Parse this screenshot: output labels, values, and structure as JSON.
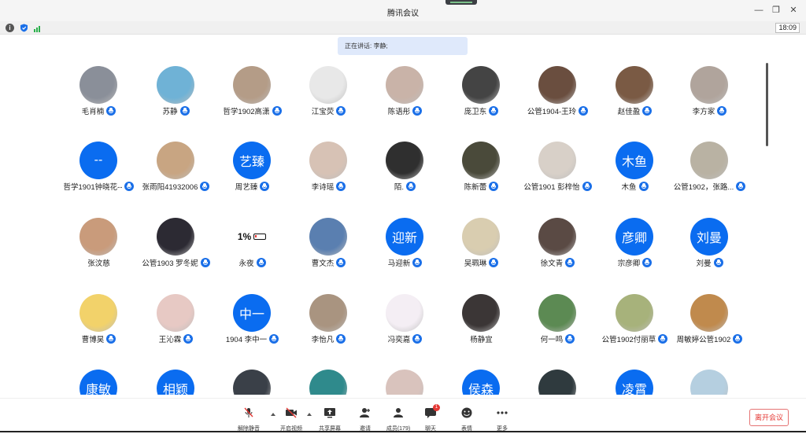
{
  "window": {
    "title": "腾讯会议",
    "controls": [
      "—",
      "❐",
      "✕"
    ]
  },
  "status": {
    "time": "18:09"
  },
  "speaking": {
    "label": "正在讲话: 李静;"
  },
  "colors": {
    "accent": "#0a6cf0",
    "leave": "#e53935"
  },
  "rows": [
    [
      {
        "name": "毛肖楠",
        "avatar": "photo",
        "tone": "#8a8f99",
        "mic": "on"
      },
      {
        "name": "苏静",
        "avatar": "photo",
        "tone": "#6fb2d6",
        "mic": "on"
      },
      {
        "name": "哲学1902高潇",
        "avatar": "photo",
        "tone": "#b49c87",
        "mic": "on"
      },
      {
        "name": "江宝荧",
        "avatar": "photo",
        "tone": "#e8e8e8",
        "mic": "on"
      },
      {
        "name": "陈语彤",
        "avatar": "photo",
        "tone": "#c9b3a8",
        "mic": "on"
      },
      {
        "name": "庞卫东",
        "avatar": "photo",
        "tone": "#444444",
        "mic": "on"
      },
      {
        "name": "公管1904-王玲",
        "avatar": "photo",
        "tone": "#6a4e3f",
        "mic": "on"
      },
      {
        "name": "赵佳盈",
        "avatar": "photo",
        "tone": "#7a5a44",
        "mic": "on"
      },
      {
        "name": "李方家",
        "avatar": "photo",
        "tone": "#b0a49c",
        "mic": "on"
      }
    ],
    [
      {
        "name": "哲学1901钟晓花--",
        "avatar": "text",
        "text": "--",
        "mic": "on"
      },
      {
        "name": "张雨阳41932006",
        "avatar": "photo",
        "tone": "#c8a582",
        "mic": "on"
      },
      {
        "name": "周艺臻",
        "avatar": "text",
        "text": "艺臻",
        "mic": "on"
      },
      {
        "name": "李诗瑶",
        "avatar": "photo",
        "tone": "#d7c2b5",
        "mic": "on"
      },
      {
        "name": "陌.",
        "avatar": "photo",
        "tone": "#2f2f2f",
        "mic": "on"
      },
      {
        "name": "陈新蕾",
        "avatar": "photo",
        "tone": "#4a4a3a",
        "mic": "on"
      },
      {
        "name": "公管1901 彭梓怡",
        "avatar": "photo",
        "tone": "#d8d0c8",
        "mic": "on"
      },
      {
        "name": "木鱼",
        "avatar": "text",
        "text": "木鱼",
        "mic": "on"
      },
      {
        "name": "公管1902，张路...",
        "avatar": "photo",
        "tone": "#b9b2a3",
        "mic": "on"
      }
    ],
    [
      {
        "name": "张汶慈",
        "avatar": "photo",
        "tone": "#c99b7b",
        "mic": "none"
      },
      {
        "name": "公管1903 罗冬妮",
        "avatar": "photo",
        "tone": "#2c2a33",
        "mic": "on"
      },
      {
        "name": "永夜",
        "avatar": "battery",
        "text": "1%",
        "mic": "on"
      },
      {
        "name": "曹文杰",
        "avatar": "photo",
        "tone": "#5a7fb0",
        "mic": "on"
      },
      {
        "name": "马迎新",
        "avatar": "text",
        "text": "迎新",
        "mic": "on"
      },
      {
        "name": "吴珮琳",
        "avatar": "photo",
        "tone": "#d9cdb0",
        "mic": "on"
      },
      {
        "name": "徐文青",
        "avatar": "photo",
        "tone": "#5a4a44",
        "mic": "on"
      },
      {
        "name": "宗彦卿",
        "avatar": "text",
        "text": "彦卿",
        "mic": "on"
      },
      {
        "name": "刘曼",
        "avatar": "text",
        "text": "刘曼",
        "mic": "on"
      }
    ],
    [
      {
        "name": "曹博昊",
        "avatar": "photo",
        "tone": "#f2d26a",
        "mic": "on"
      },
      {
        "name": "王沁霖",
        "avatar": "photo",
        "tone": "#e7c9c4",
        "mic": "on"
      },
      {
        "name": "1904 李中一",
        "avatar": "text",
        "text": "中一",
        "mic": "on"
      },
      {
        "name": "李怡凡",
        "avatar": "photo",
        "tone": "#a99480",
        "mic": "on"
      },
      {
        "name": "冯奕嘉",
        "avatar": "photo",
        "tone": "#f4eef4",
        "mic": "on"
      },
      {
        "name": "杨静宜",
        "avatar": "photo",
        "tone": "#3b3636",
        "mic": "none"
      },
      {
        "name": "何一鸣",
        "avatar": "photo",
        "tone": "#5c8a53",
        "mic": "on"
      },
      {
        "name": "公管1902付丽草",
        "avatar": "photo",
        "tone": "#a7b27b",
        "mic": "on"
      },
      {
        "name": "周敏婷公管1902",
        "avatar": "photo",
        "tone": "#c08a4d",
        "mic": "on"
      }
    ],
    [
      {
        "name": "",
        "avatar": "text",
        "text": "康敏",
        "mic": "none"
      },
      {
        "name": "",
        "avatar": "text",
        "text": "相颖",
        "mic": "none"
      },
      {
        "name": "",
        "avatar": "photo",
        "tone": "#3a4048",
        "mic": "none"
      },
      {
        "name": "",
        "avatar": "photo",
        "tone": "#2f8a8c",
        "mic": "none"
      },
      {
        "name": "",
        "avatar": "photo",
        "tone": "#d9c3bd",
        "mic": "none"
      },
      {
        "name": "",
        "avatar": "text",
        "text": "侯森",
        "mic": "none"
      },
      {
        "name": "",
        "avatar": "photo",
        "tone": "#2f3a3e",
        "mic": "none"
      },
      {
        "name": "",
        "avatar": "text",
        "text": "凌霄",
        "mic": "none"
      },
      {
        "name": "",
        "avatar": "photo",
        "tone": "#b5cfe0",
        "mic": "none"
      }
    ]
  ],
  "toolbar": {
    "unmute": "解除静音",
    "video": "开启视频",
    "share": "共享屏幕",
    "invite": "邀请",
    "members": "成员(179)",
    "chat": "聊天",
    "chat_badge": "1",
    "reactions": "表情",
    "more": "更多",
    "leave": "离开会议"
  }
}
